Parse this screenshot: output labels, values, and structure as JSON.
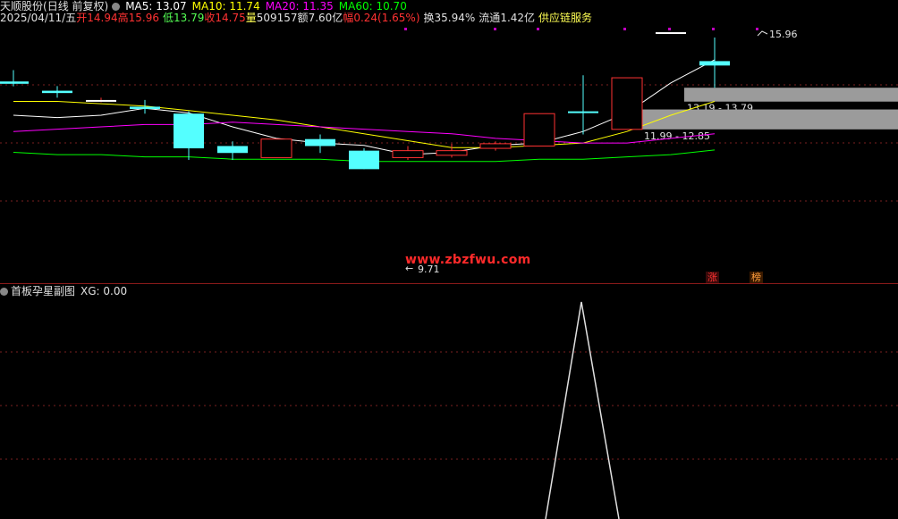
{
  "header": {
    "stock_name": "天顺股份",
    "period": "(日线 前复权)",
    "ma5_label": "MA5:",
    "ma5_value": "13.07",
    "ma10_label": "MA10:",
    "ma10_value": "11.74",
    "ma20_label": "MA20:",
    "ma20_value": "11.35",
    "ma60_label": "MA60:",
    "ma60_value": "10.70"
  },
  "quote": {
    "date": "2025/04/11/五",
    "open_label": "开",
    "open": "14.94",
    "high_label": "高",
    "high": "15.96",
    "low_label": "低",
    "low": "13.79",
    "close_label": "收",
    "close": "14.75",
    "volume_label": "量",
    "volume": "509157",
    "amount_label": "额",
    "amount": "7.60亿",
    "change_label": "幅",
    "change": "0.24(1.65%)",
    "turnover_label": "换",
    "turnover": "35.94%",
    "float_label": "流通",
    "float": "1.42亿",
    "concept": "供应链服务"
  },
  "chart_annotations": {
    "high_price": "15.96",
    "low_price": "9.71",
    "gap_upper": "13.19 - 13.79",
    "gap_lower": "11.99 - 12.85",
    "limit_up_badge": "涨",
    "dragon_tiger_badge": "榜"
  },
  "watermark": "www.zbzfwu.com",
  "sub_chart": {
    "title": "首板孕星副图",
    "xg_label": "XG:",
    "xg_value": "0.00"
  },
  "colors": {
    "background": "#000000",
    "up": "#ff3232",
    "down": "#54ffff",
    "ma5": "#ffffff",
    "ma10": "#ffff00",
    "ma20": "#ff00ff",
    "ma60": "#00ff00",
    "grid": "#7a1f1f",
    "gap_box": "#9b9b9b"
  },
  "chart_data": {
    "type": "candlestick",
    "dates_shown": [
      "2025/04/11"
    ],
    "candles": [
      {
        "open": 14.06,
        "close": 13.96,
        "high": 14.55,
        "low": 13.85
      },
      {
        "open": 13.66,
        "close": 13.56,
        "high": 13.86,
        "low": 13.36
      },
      {
        "open": 13.26,
        "close": 13.26,
        "high": 13.36,
        "low": 13.16
      },
      {
        "open": 12.97,
        "close": 12.87,
        "high": 13.26,
        "low": 12.67
      },
      {
        "open": 12.67,
        "close": 11.17,
        "high": 12.77,
        "low": 10.67
      },
      {
        "open": 11.27,
        "close": 10.97,
        "high": 11.47,
        "low": 10.67
      },
      {
        "open": 10.77,
        "close": 11.57,
        "high": 11.57,
        "low": 10.77
      },
      {
        "open": 11.57,
        "close": 11.27,
        "high": 11.77,
        "low": 10.97
      },
      {
        "open": 11.07,
        "close": 10.27,
        "high": 11.17,
        "low": 10.27
      },
      {
        "open": 10.77,
        "close": 11.07,
        "high": 11.27,
        "low": 10.67
      },
      {
        "open": 10.87,
        "close": 11.07,
        "high": 11.37,
        "low": 10.77
      },
      {
        "open": 11.17,
        "close": 11.37,
        "high": 11.47,
        "low": 11.07
      },
      {
        "open": 11.27,
        "close": 12.67,
        "high": 12.67,
        "low": 11.27
      },
      {
        "open": 12.77,
        "close": 12.72,
        "high": 14.33,
        "low": 11.77
      },
      {
        "open": 11.99,
        "close": 14.22,
        "high": 14.22,
        "low": 11.99
      },
      {
        "open": 16.19,
        "close": 16.19,
        "high": 16.19,
        "low": 16.19
      },
      {
        "open": 14.94,
        "close": 14.75,
        "high": 15.96,
        "low": 13.79
      }
    ],
    "ma_series": [
      {
        "name": "MA5",
        "values": [
          12.6,
          12.5,
          12.6,
          12.9,
          12.7,
          12.1,
          11.6,
          11.4,
          11.3,
          10.9,
          11.0,
          11.3,
          11.4,
          11.9,
          12.7,
          14.0,
          15.0
        ]
      },
      {
        "name": "MA10",
        "values": [
          13.2,
          13.2,
          13.1,
          13.0,
          12.8,
          12.6,
          12.4,
          12.1,
          11.8,
          11.5,
          11.2,
          11.2,
          11.3,
          11.4,
          11.9,
          12.6,
          13.2
        ]
      },
      {
        "name": "MA20",
        "values": [
          11.9,
          12.0,
          12.1,
          12.2,
          12.2,
          12.3,
          12.2,
          12.1,
          12.0,
          11.9,
          11.8,
          11.6,
          11.5,
          11.4,
          11.4,
          11.6,
          11.8
        ]
      },
      {
        "name": "MA60",
        "values": [
          11.0,
          10.9,
          10.9,
          10.8,
          10.8,
          10.7,
          10.7,
          10.7,
          10.6,
          10.6,
          10.6,
          10.6,
          10.7,
          10.7,
          10.8,
          10.9,
          11.1
        ]
      }
    ],
    "gaps": [
      {
        "low": 13.19,
        "high": 13.79
      },
      {
        "low": 11.99,
        "high": 12.85
      }
    ],
    "sub_series": {
      "name": "XG",
      "spike_index": 13,
      "values": [
        0,
        0,
        0,
        0,
        0,
        0,
        0,
        0,
        0,
        0,
        0,
        0,
        0,
        1,
        0,
        0,
        0
      ]
    }
  }
}
